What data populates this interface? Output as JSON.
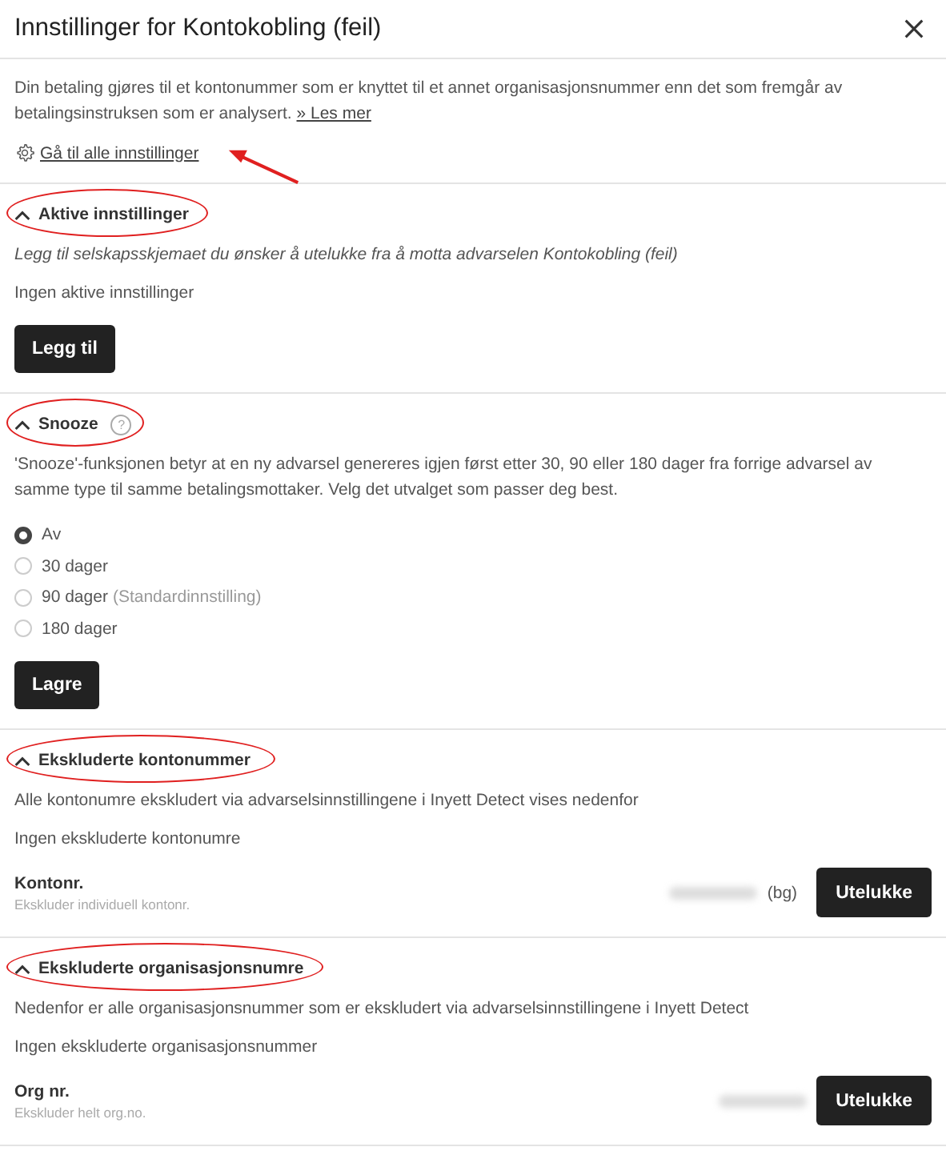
{
  "dialog": {
    "title": "Innstillinger for Kontokobling (feil)",
    "intro": "Din betaling gjøres til et kontonummer som er knyttet til et annet organisasjonsnummer enn det som fremgår av betalingsinstruksen som er analysert.",
    "intro_link": "» Les mer",
    "settings_link": "Gå til alle innstillinger",
    "settings_link_pointed": true
  },
  "sections": [
    {
      "kind": "active",
      "title": "Aktive innstillinger",
      "expanded": true,
      "circled": true,
      "description": "Legg til selskapsskjemaet du ønsker å utelukke fra å motta advarselen Kontokobling (feil)",
      "empty_text": "Ingen aktive innstillinger",
      "button": "Legg til"
    },
    {
      "kind": "snooze",
      "title": "Snooze",
      "expanded": true,
      "circled": true,
      "help": "?",
      "description": "'Snooze'-funksjonen betyr at en ny advarsel genereres igjen først etter 30, 90 eller 180 dager fra forrige advarsel av samme type til samme betalingsmottaker. Velg det utvalget som passer deg best.",
      "options": [
        {
          "label": "Av",
          "selected": true
        },
        {
          "label": "30 dager",
          "selected": false
        },
        {
          "label": "90 dager",
          "note": "(Standardinnstilling)",
          "selected": false
        },
        {
          "label": "180 dager",
          "selected": false
        }
      ],
      "button": "Lagre"
    },
    {
      "kind": "exclusion",
      "title": "Ekskluderte kontonummer",
      "expanded": true,
      "circled": true,
      "description": "Alle kontonumre ekskludert via advarselsinnstillingene i Inyett Detect vises nedenfor",
      "empty_text": "Ingen ekskluderte kontonumre",
      "field_label": "Kontonr.",
      "field_hint": "Ekskluder individuell kontonr.",
      "suffix": "(bg)",
      "button": "Utelukke"
    },
    {
      "kind": "exclusion",
      "title": "Ekskluderte organisasjonsnumre",
      "expanded": true,
      "circled": true,
      "description": "Nedenfor er alle organisasjonsnummer som er ekskludert via advarselsinnstillingene i Inyett Detect",
      "empty_text": "Ingen ekskluderte organisasjonsnummer",
      "field_label": "Org nr.",
      "field_hint": "Ekskluder helt org.no.",
      "button": "Utelukke"
    }
  ]
}
